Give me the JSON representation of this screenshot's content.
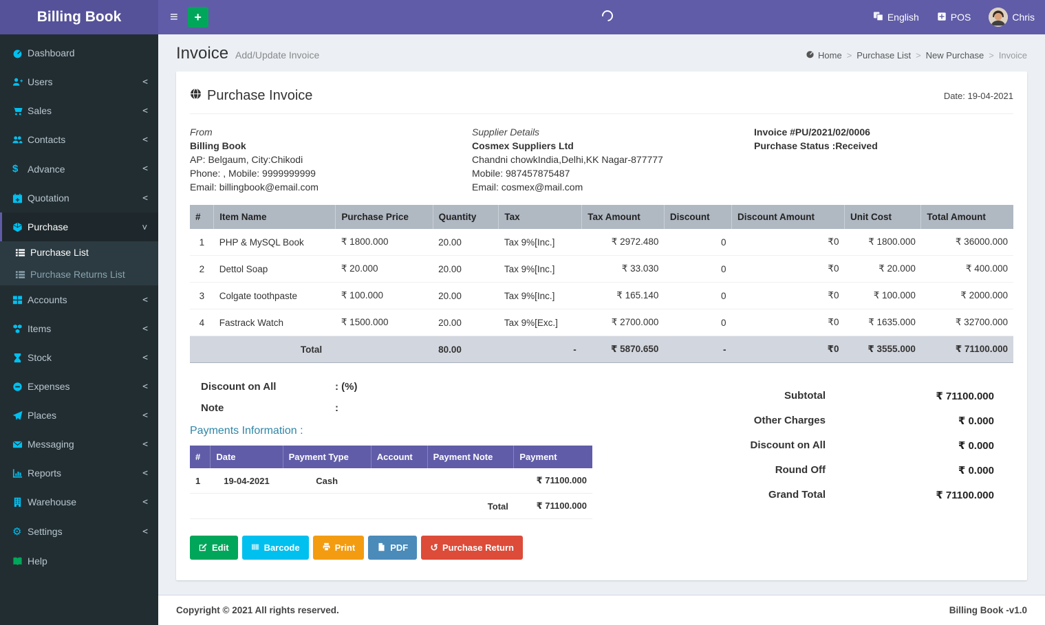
{
  "colors": {
    "topbar": "#605ca8",
    "logo_bg": "#555299",
    "sidebar_bg": "#222d32",
    "sidebar_icon": "#00c0ef",
    "items_header_bg": "#b0b8c2",
    "total_row_bg": "#d2d6de",
    "payments_header_bg": "#605ca8",
    "payments_heading_text": "#2e86a8",
    "btn_edit": "#00a65a",
    "btn_barcode": "#00c0ef",
    "btn_print": "#f39c12",
    "btn_pdf": "#4a8bba",
    "btn_return": "#dd4b39"
  },
  "topbar": {
    "brand": "Billing Book",
    "language": "English",
    "pos": "POS",
    "user": "Chris"
  },
  "sidebar": {
    "items": [
      {
        "label": "Dashboard"
      },
      {
        "label": "Users"
      },
      {
        "label": "Sales"
      },
      {
        "label": "Contacts"
      },
      {
        "label": "Advance"
      },
      {
        "label": "Quotation"
      },
      {
        "label": "Purchase",
        "children": [
          {
            "label": "Purchase List"
          },
          {
            "label": "Purchase Returns List"
          }
        ]
      },
      {
        "label": "Accounts"
      },
      {
        "label": "Items"
      },
      {
        "label": "Stock"
      },
      {
        "label": "Expenses"
      },
      {
        "label": "Places"
      },
      {
        "label": "Messaging"
      },
      {
        "label": "Reports"
      },
      {
        "label": "Warehouse"
      },
      {
        "label": "Settings"
      },
      {
        "label": "Help"
      }
    ]
  },
  "page": {
    "title": "Invoice",
    "subtitle": "Add/Update Invoice",
    "breadcrumb": {
      "home": "Home",
      "purchase_list": "Purchase List",
      "new_purchase": "New Purchase",
      "current": "Invoice"
    }
  },
  "invoice": {
    "card_title": "Purchase Invoice",
    "date": "Date: 19-04-2021",
    "from": {
      "heading": "From",
      "name": "Billing Book",
      "address": "AP: Belgaum, City:Chikodi",
      "phone": "Phone: , Mobile: 9999999999",
      "email": "Email: billingbook@email.com"
    },
    "supplier": {
      "heading": "Supplier Details",
      "name": "Cosmex Suppliers Ltd",
      "address": "Chandni chowkIndia,Delhi,KK Nagar-877777",
      "phone": "Mobile: 987457875487",
      "email": "Email: cosmex@mail.com"
    },
    "meta": {
      "number": "Invoice #PU/2021/02/0006",
      "status": "Purchase Status :Received"
    },
    "items_table": {
      "headers": [
        "#",
        "Item Name",
        "Purchase Price",
        "Quantity",
        "Tax",
        "Tax Amount",
        "Discount",
        "Discount Amount",
        "Unit Cost",
        "Total Amount"
      ],
      "rows": [
        [
          "1",
          "PHP & MySQL Book",
          "₹ 1800.000",
          "20.00",
          "Tax 9%[Inc.]",
          "₹ 2972.480",
          "0",
          "₹0",
          "₹ 1800.000",
          "₹ 36000.000"
        ],
        [
          "2",
          "Dettol Soap",
          "₹ 20.000",
          "20.00",
          "Tax 9%[Inc.]",
          "₹ 33.030",
          "0",
          "₹0",
          "₹ 20.000",
          "₹ 400.000"
        ],
        [
          "3",
          "Colgate toothpaste",
          "₹ 100.000",
          "20.00",
          "Tax 9%[Inc.]",
          "₹ 165.140",
          "0",
          "₹0",
          "₹ 100.000",
          "₹ 2000.000"
        ],
        [
          "4",
          "Fastrack Watch",
          "₹ 1500.000",
          "20.00",
          "Tax 9%[Exc.]",
          "₹ 2700.000",
          "0",
          "₹0",
          "₹ 1635.000",
          "₹ 32700.000"
        ]
      ],
      "total_row": {
        "label": "Total",
        "quantity": "80.00",
        "tax": "-",
        "tax_amount": "₹ 5870.650",
        "discount": "-",
        "discount_amount": "₹0",
        "unit_cost": "₹ 3555.000",
        "total_amount": "₹ 71100.000"
      }
    },
    "discount_on_all": {
      "label": "Discount on All",
      "value": ": (%)"
    },
    "note": {
      "label": "Note",
      "value": ":"
    },
    "payments": {
      "heading": "Payments Information :",
      "headers": [
        "#",
        "Date",
        "Payment Type",
        "Account",
        "Payment Note",
        "Payment"
      ],
      "rows": [
        [
          "1",
          "19-04-2021",
          "Cash",
          "",
          "",
          "₹ 71100.000"
        ]
      ],
      "total_label": "Total",
      "total_value": "₹ 71100.000"
    },
    "summary": [
      {
        "label": "Subtotal",
        "value": "₹ 71100.000"
      },
      {
        "label": "Other Charges",
        "value": "₹ 0.000"
      },
      {
        "label": "Discount on All",
        "value": "₹ 0.000"
      },
      {
        "label": "Round Off",
        "value": "₹ 0.000"
      },
      {
        "label": "Grand Total",
        "value": "₹ 71100.000"
      }
    ],
    "buttons": {
      "edit": "Edit",
      "barcode": "Barcode",
      "print": "Print",
      "pdf": "PDF",
      "purchase_return": "Purchase Return"
    }
  },
  "footer": {
    "copyright": "Copyright © 2021 All rights reserved.",
    "version": "Billing Book -v1.0"
  }
}
